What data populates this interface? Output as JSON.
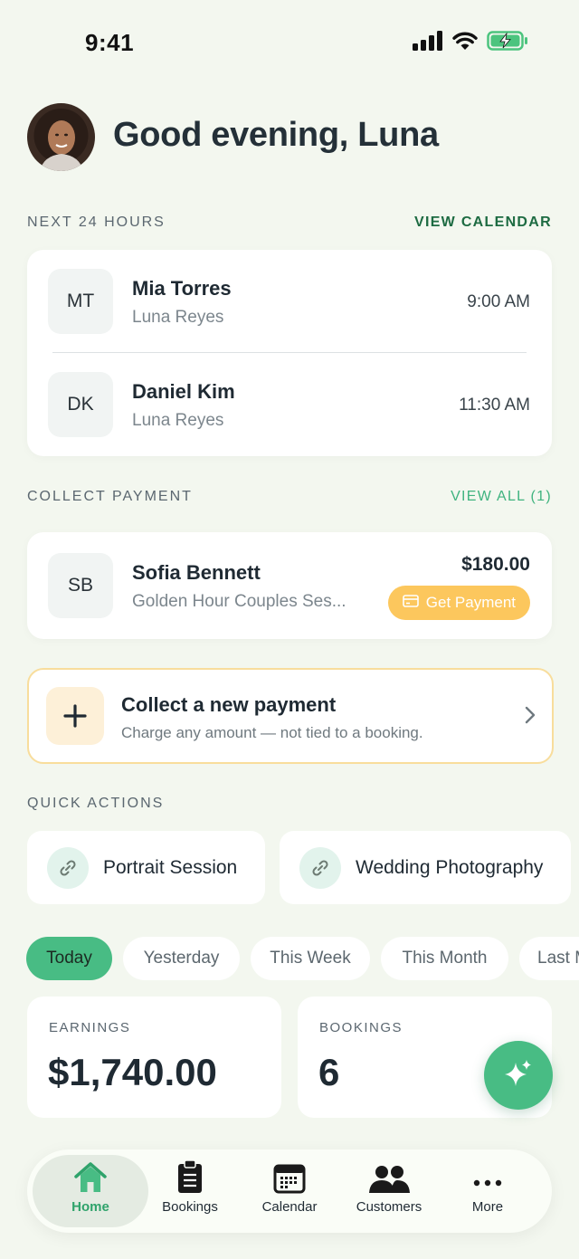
{
  "status_bar": {
    "time": "9:41"
  },
  "greeting": "Good evening, Luna",
  "next24": {
    "title": "NEXT 24 HOURS",
    "link": "VIEW CALENDAR",
    "items": [
      {
        "initials": "MT",
        "name": "Mia Torres",
        "sub": "Luna Reyes",
        "time": "9:00 AM"
      },
      {
        "initials": "DK",
        "name": "Daniel Kim",
        "sub": "Luna Reyes",
        "time": "11:30 AM"
      }
    ]
  },
  "collect": {
    "title": "COLLECT PAYMENT",
    "link": "VIEW ALL (1)",
    "item": {
      "initials": "SB",
      "name": "Sofia Bennett",
      "sub": "Golden Hour Couples Ses...",
      "amount": "$180.00",
      "button": "Get Payment"
    }
  },
  "new_payment": {
    "title": "Collect a new payment",
    "sub": "Charge any amount — not tied to a booking."
  },
  "quick_actions": {
    "title": "QUICK ACTIONS",
    "items": [
      "Portrait Session",
      "Wedding Photography"
    ]
  },
  "filters": [
    "Today",
    "Yesterday",
    "This Week",
    "This Month",
    "Last M"
  ],
  "stats": [
    {
      "label": "EARNINGS",
      "value": "$1,740.00"
    },
    {
      "label": "BOOKINGS",
      "value": "6"
    }
  ],
  "tabs": [
    "Home",
    "Bookings",
    "Calendar",
    "Customers",
    "More"
  ],
  "colors": {
    "accent": "#48bc84",
    "payment_button": "#fcc75d",
    "background": "#f3f7ef"
  }
}
